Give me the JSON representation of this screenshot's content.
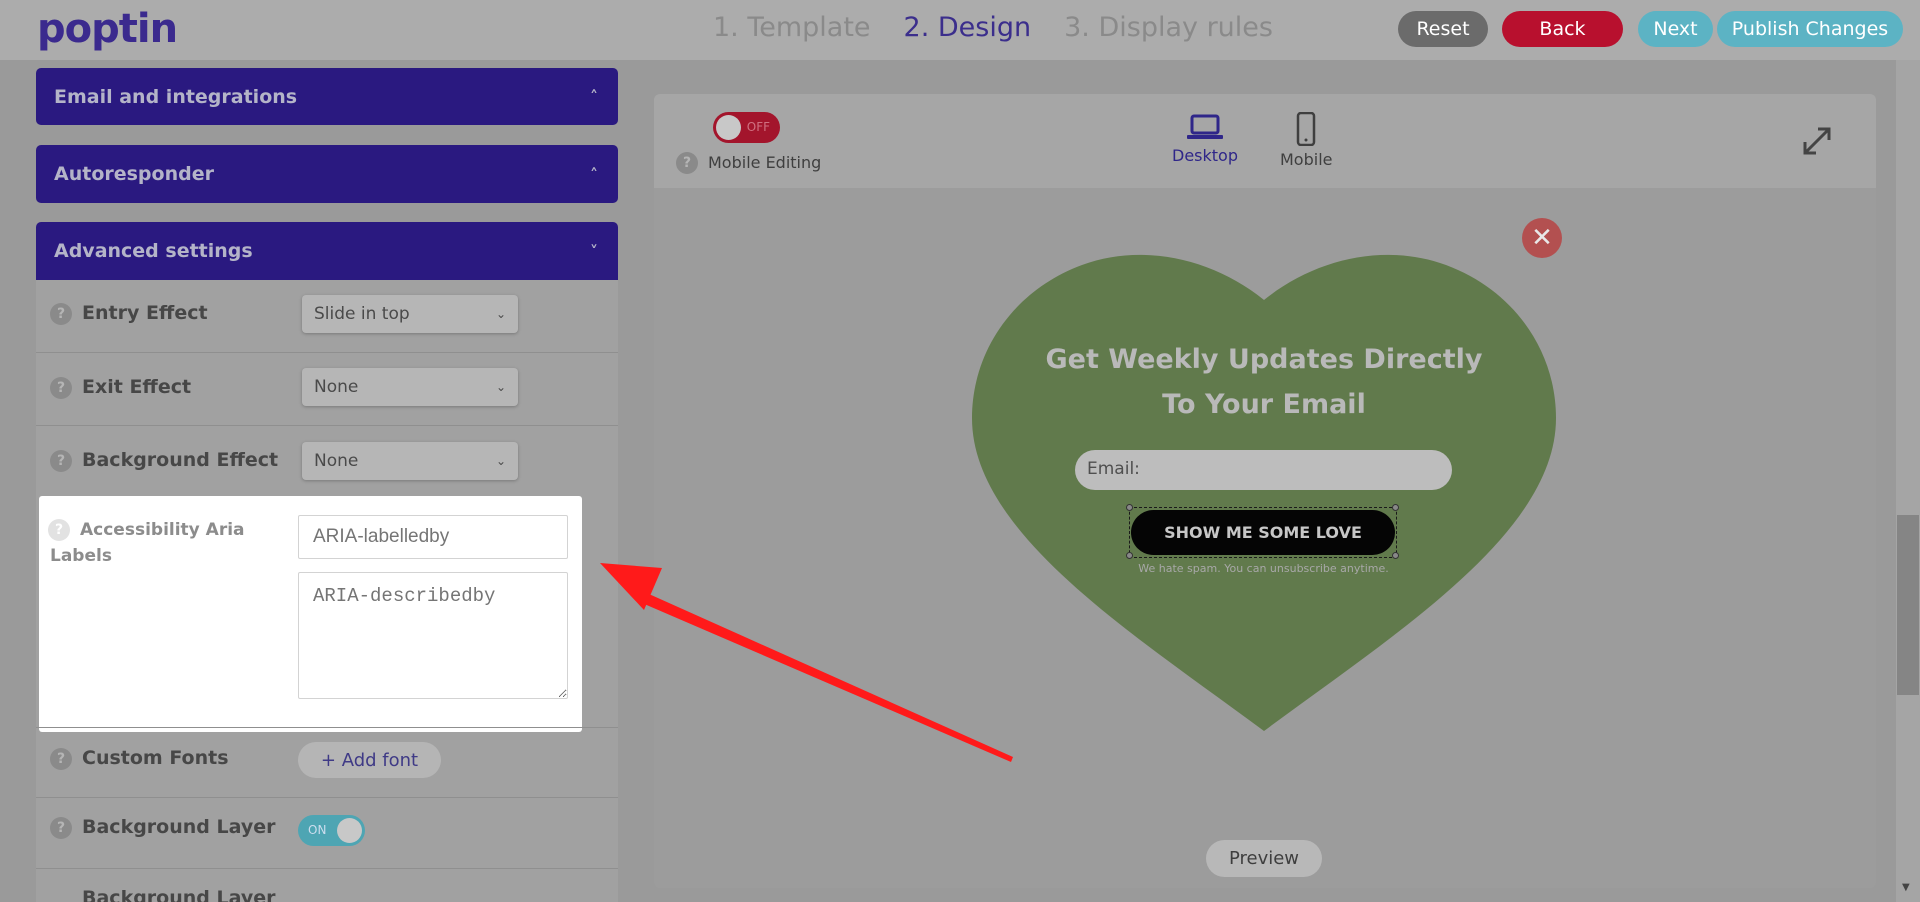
{
  "brand": {
    "logo": "poptin"
  },
  "steps": [
    {
      "label": "1. Template"
    },
    {
      "label": "2. Design"
    },
    {
      "label": "3. Display rules"
    }
  ],
  "top_buttons": {
    "reset": "Reset",
    "back": "Back",
    "next": "Next",
    "publish": "Publish Changes"
  },
  "sidebar": {
    "sections": [
      {
        "label": "Email and integrations",
        "state": "collapsed"
      },
      {
        "label": "Autoresponder",
        "state": "collapsed"
      },
      {
        "label": "Advanced settings",
        "state": "expanded"
      }
    ],
    "rows": {
      "entry_effect": {
        "label": "Entry Effect",
        "value": "Slide in top"
      },
      "exit_effect": {
        "label": "Exit Effect",
        "value": "None"
      },
      "background_effect": {
        "label": "Background Effect",
        "value": "None"
      },
      "aria": {
        "label": "Accessibility Aria Labels",
        "labelledby_placeholder": "ARIA-labelledby",
        "describedby_placeholder": "ARIA-describedby"
      },
      "custom_fonts": {
        "label": "Custom Fonts",
        "button": "+ Add font"
      },
      "background_layer": {
        "label": "Background Layer",
        "toggle": "ON"
      },
      "background_layer_2": {
        "label": "Background Layer"
      }
    }
  },
  "editor": {
    "mobile_editing": {
      "label": "Mobile Editing",
      "toggle": "OFF"
    },
    "devices": [
      {
        "label": "Desktop",
        "selected": true
      },
      {
        "label": "Mobile",
        "selected": false
      }
    ],
    "popup": {
      "title": "Get Weekly Updates Directly To Your Email",
      "email_placeholder": "Email:",
      "button": "SHOW ME SOME LOVE",
      "note": "We hate spam. You can unsubscribe anytime.",
      "shape_color": "#617a4c"
    },
    "preview_button": "Preview"
  },
  "colors": {
    "accent": "#2a1980",
    "back": "#b8102e",
    "teal": "#5cb3c4",
    "annotation": "#ff1a1a"
  }
}
